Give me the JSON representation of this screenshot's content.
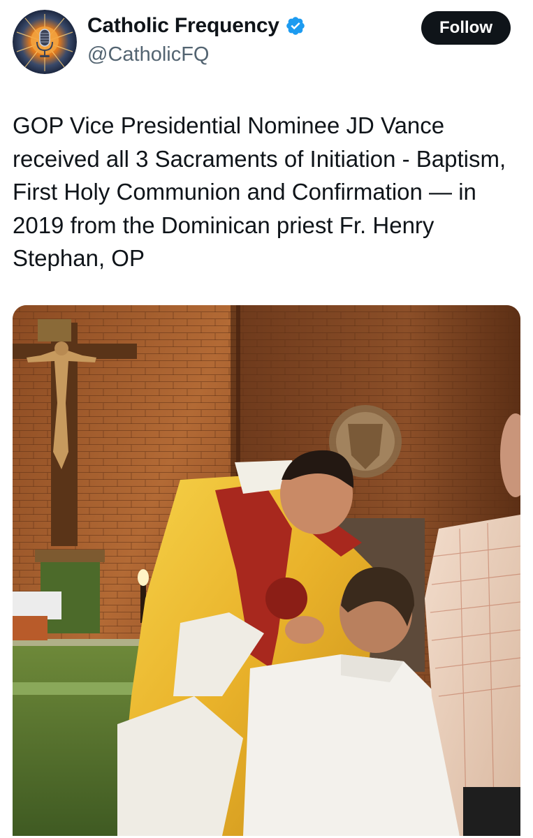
{
  "account": {
    "display_name": "Catholic Frequency",
    "handle": "@CatholicFQ",
    "verified": true,
    "avatar_icon": "microphone-sunburst-icon"
  },
  "follow_button": {
    "label": "Follow"
  },
  "tweet": {
    "text": "GOP Vice Presidential Nominee JD Vance received all 3 Sacraments of Initiation - Baptism, First Holy Communion and Confirmation — in 2019 from the Dominican priest Fr. Henry Stephan, OP"
  },
  "media": {
    "alt_subject": "photo"
  },
  "colors": {
    "verified_blue": "#1d9bf0",
    "text_primary": "#0f1419",
    "text_secondary": "#536471",
    "button_bg": "#0f1419"
  }
}
